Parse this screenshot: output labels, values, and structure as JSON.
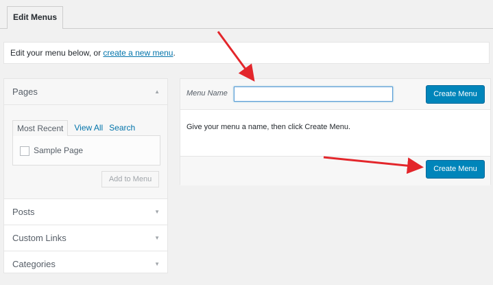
{
  "tabs": {
    "active": "Edit Menus"
  },
  "notice": {
    "prefix": "Edit your menu below, or ",
    "link": "create a new menu",
    "suffix": "."
  },
  "sidebar": {
    "pages": {
      "title": "Pages",
      "subtabs": [
        "Most Recent",
        "View All",
        "Search"
      ],
      "items": [
        {
          "label": "Sample Page",
          "checked": false
        }
      ],
      "add_button": "Add to Menu"
    },
    "sections": [
      "Posts",
      "Custom Links",
      "Categories"
    ]
  },
  "menu": {
    "name_label": "Menu Name",
    "name_value": "",
    "create_button": "Create Menu",
    "instructions": "Give your menu a name, then click Create Menu."
  },
  "colors": {
    "primary": "#0085ba",
    "link": "#0073aa",
    "arrow": "#e3262b"
  },
  "icons": {
    "collapse": "triangle-up-icon",
    "expand": "triangle-down-icon"
  }
}
